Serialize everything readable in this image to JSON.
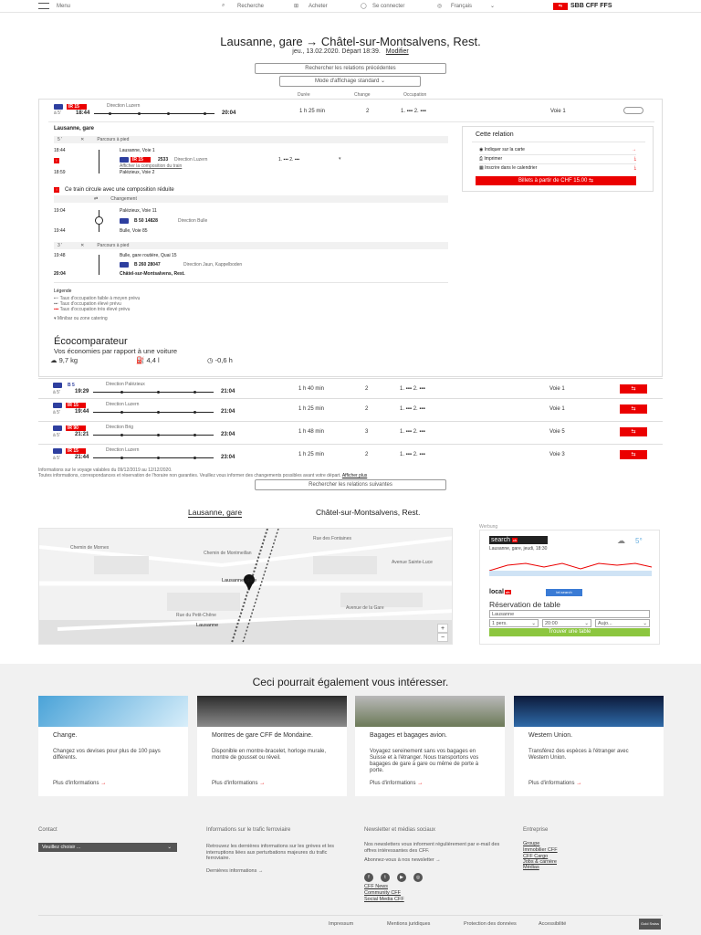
{
  "nav": {
    "menu": "Menu",
    "search": "Recherche",
    "buy": "Acheter",
    "login": "Se connecter",
    "lang": "Français",
    "brand": "SBB CFF FFS"
  },
  "header": {
    "title": "Lausanne, gare → Châtel-sur-Montsalvens, Rest.",
    "subtitle": "jeu., 13.02.2020. Départ 18:39.",
    "modify": "Modifier",
    "prev_btn": "Rechercher les relations précédentes",
    "display_mode": "Mode d'affichage standard"
  },
  "columns": {
    "duration": "Durée",
    "changes": "Change",
    "occupancy": "Occupation"
  },
  "connection1": {
    "train": "IR 15",
    "direction": "Direction Luzern",
    "platform_abbr": "à 5'",
    "dep": "18:44",
    "arr": "20:04",
    "duration": "1 h 25 min",
    "changes": "2",
    "occ": "1. ▪▪▪ 2. ▪▪▪",
    "platform": "Voie 1"
  },
  "detail": {
    "origin": "Lausanne, gare",
    "walk1": "Parcours à pied",
    "walk1_min": "5 '",
    "leg1_dep_time": "18:44",
    "leg1_dep": "Lausanne, Voie 1",
    "leg1_train": "IR 15",
    "leg1_no": "2533",
    "leg1_dir": "Direction Luzern",
    "leg1_comp": "Afficher la composition du train",
    "leg1_arr_time": "18:59",
    "leg1_arr": "Palézieux, Voie 2",
    "leg1_occ": "1. ▪▪▪ 2. ▪▪▪",
    "notice": "Ce train circule avec une composition réduite",
    "change": "Changement",
    "leg2_dep_time": "19:04",
    "leg2_dep": "Palézieux, Voie 11",
    "leg2_no": "B 50 14828",
    "leg2_dir": "Direction Bulle",
    "leg2_arr_time": "19:44",
    "leg2_arr": "Bulle, Voie 85",
    "walk2": "Parcours à pied",
    "walk2_min": "3 '",
    "leg3_dep_time": "19:48",
    "leg3_dep": "Bulle, gare routière, Quai 15",
    "leg3_no": "B 260 28047",
    "leg3_dir": "Direction Jaun, Kappelboden",
    "leg3_arr_time": "20:04",
    "leg3_arr": "Châtel-sur-Montsalvens, Rest.",
    "legend": "Légende",
    "legend1": "Taux d'occupation faible à moyen prévu",
    "legend2": "Taux d'occupation élevé prévu",
    "legend3": "Taux d'occupation très élevé prévu",
    "legend4": "Minibar ou zone catering"
  },
  "relation": {
    "title": "Cette relation",
    "map": "Indiquer sur la carte",
    "print": "Imprimer",
    "calendar": "Inscrire dans le calendrier",
    "tickets": "Billets à partir de CHF 15.00"
  },
  "eco": {
    "title": "Écocomparateur",
    "subtitle": "Vos économies par rapport à une voiture",
    "co2": "9,7 kg",
    "energy": "4,4 l",
    "time": "-0,6 h"
  },
  "connections": [
    {
      "train": "B 5",
      "direction": "Direction Palézieux",
      "platform_abbr": "à 5'",
      "dep": "19:29",
      "arr": "21:04",
      "duration": "1 h 40 min",
      "changes": "2",
      "occ": "1. ▪▪▪ 2. ▪▪▪",
      "platform": "Voie 1"
    },
    {
      "train": "IR 15",
      "direction": "Direction Luzern",
      "platform_abbr": "à 5'",
      "dep": "19:44",
      "arr": "21:04",
      "duration": "1 h 25 min",
      "changes": "2",
      "occ": "1. ▪▪▪ 2. ▪▪▪",
      "platform": "Voie 1"
    },
    {
      "train": "IR 90",
      "direction": "Direction Brig",
      "platform_abbr": "à 5'",
      "dep": "21:21",
      "arr": "23:04",
      "duration": "1 h 48 min",
      "changes": "3",
      "occ": "1. ▪▪▪ 2. ▪▪▪",
      "platform": "Voie 5"
    },
    {
      "train": "IR 15",
      "direction": "Direction Luzern",
      "platform_abbr": "à 5'",
      "dep": "21:44",
      "arr": "23:04",
      "duration": "1 h 25 min",
      "changes": "2",
      "occ": "1. ▪▪▪ 2. ▪▪▪",
      "platform": "Voie 3"
    }
  ],
  "info": {
    "line1": "Informations sur le voyage valables du 09/12/2019 au 12/12/2020.",
    "line2": "Toutes informations, correspondances et réservation de l'horaire non garanties. Veuillez vous informer des changements possibles avant votre départ.",
    "more": "Afficher plus",
    "next_btn": "Rechercher les relations suivantes"
  },
  "map": {
    "from": "Lausanne, gare",
    "to": "Châtel-sur-Montsalvens, Rest.",
    "marker": "Lausanne, gare",
    "label": "Lausanne",
    "streets": [
      "Chemin de Mornex",
      "Avenue de la Gare",
      "Avenue Sainte-Luce",
      "Chemin de Montmeillan",
      "Rue du Petit-Chêne",
      "Rue des Fontaines"
    ]
  },
  "ad": {
    "label": "Werbung",
    "search": "search",
    "weather": "Lausanne, gare, jeudi, 18:30",
    "temp": "5°",
    "local": "local",
    "local2": "tel.search",
    "reservation": "Réservation de table",
    "field": "Lausanne",
    "persons": "1 pers.",
    "hour": "20:00",
    "date": "Aujo...",
    "find": "Trouver une table"
  },
  "interest": {
    "title": "Ceci pourrait également vous intéresser.",
    "cards": [
      {
        "title": "Change.",
        "desc": "Changez vos devises pour plus de 100 pays différents.",
        "more": "Plus d'informations"
      },
      {
        "title": "Montres de gare CFF de Mondaine.",
        "desc": "Disponible en montre-bracelet, horloge murale, montre de gousset ou réveil.",
        "more": "Plus d'informations"
      },
      {
        "title": "Bagages et bagages avion.",
        "desc": "Voyagez sereinement sans vos bagages en Suisse et à l'étranger. Nous transportons vos bagages de gare à gare ou même de porte à porte.",
        "more": "Plus d'informations"
      },
      {
        "title": "Western Union.",
        "desc": "Transférez des espèces à l'étranger avec Western Union.",
        "more": "Plus d'informations"
      }
    ]
  },
  "footer": {
    "contact": "Contact",
    "choose": "Veuillez choisir ...",
    "traffic": "Informations sur le trafic ferroviaire",
    "traffic_text": "Retrouvez les dernières informations sur les grèves et les interruptions liées aux perturbations majeures du trafic ferroviaire.",
    "traffic_link": "Dernières informations",
    "newsletter": "Newsletter et médias sociaux",
    "newsletter_text": "Nos newsletters vous informent régulièrement par e-mail des offres intéressantes des CFF.",
    "newsletter_link": "Abonnez-vous à nos newsletter",
    "news": "CFF News",
    "community": "Community CFF",
    "social": "Social Media CFF",
    "company": "Entreprise",
    "c1": "Groupe",
    "c2": "Immobilier CFF",
    "c3": "CFF Cargo",
    "c4": "Jobs & carrière",
    "c5": "Médias",
    "impressum": "Impressum",
    "legal": "Mentions juridiques",
    "privacy": "Protection des données",
    "access": "Accessibilité",
    "badge": "Gold Swiss"
  },
  "colors": {
    "red": "#eb0000",
    "blue": "#2e3f9f"
  }
}
